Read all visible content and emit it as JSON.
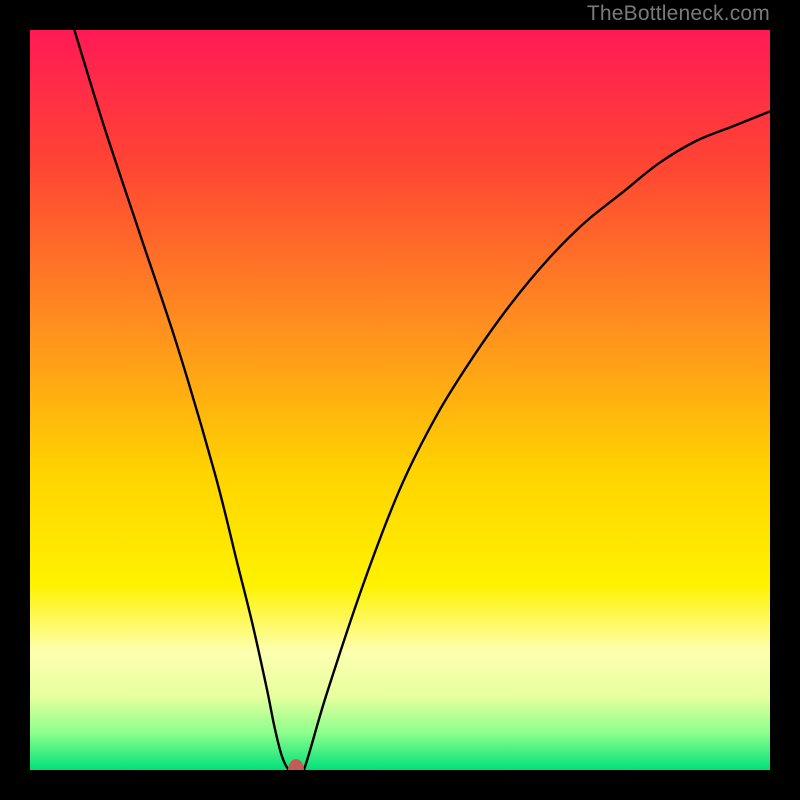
{
  "watermark": {
    "text": "TheBottleneck.com"
  },
  "colors": {
    "black": "#000000",
    "curve": "#000000",
    "dot": "#c55a57",
    "gradient_stops": [
      {
        "pct": 0,
        "color": "#ff1a55"
      },
      {
        "pct": 18,
        "color": "#ff4433"
      },
      {
        "pct": 40,
        "color": "#ff8f1f"
      },
      {
        "pct": 60,
        "color": "#ffd400"
      },
      {
        "pct": 75,
        "color": "#fff200"
      },
      {
        "pct": 84,
        "color": "#fdffb0"
      },
      {
        "pct": 90,
        "color": "#e8ff9e"
      },
      {
        "pct": 95,
        "color": "#8cff8c"
      },
      {
        "pct": 100,
        "color": "#00e07a"
      }
    ]
  },
  "chart_data": {
    "type": "line",
    "title": "",
    "xlabel": "",
    "ylabel": "",
    "xlim": [
      0,
      100
    ],
    "ylim": [
      0,
      100
    ],
    "series": [
      {
        "name": "bottleneck-curve",
        "x": [
          6,
          10,
          15,
          20,
          25,
          28,
          30,
          32,
          33,
          34,
          35,
          36,
          37,
          40,
          45,
          50,
          55,
          60,
          65,
          70,
          75,
          80,
          85,
          90,
          95,
          100
        ],
        "y": [
          100,
          87,
          72,
          57,
          40,
          28,
          20,
          11,
          6,
          2,
          0,
          0,
          0,
          10,
          25,
          38,
          48,
          56,
          63,
          69,
          74,
          78,
          82,
          85,
          87,
          89
        ]
      }
    ],
    "marker": {
      "x": 36,
      "y": 0
    },
    "background": "rainbow-vertical-gradient"
  }
}
